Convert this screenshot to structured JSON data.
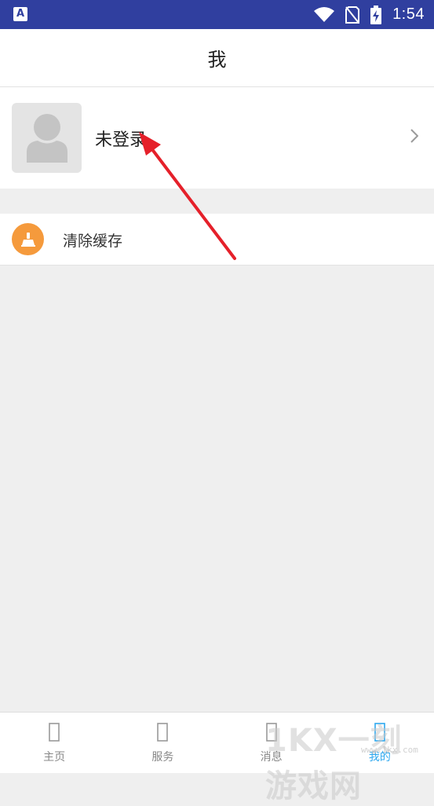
{
  "status_bar": {
    "app_badge": "A",
    "time": "1:54",
    "icons": [
      "wifi-icon",
      "no-sim-icon",
      "battery-charging-icon"
    ]
  },
  "header": {
    "title": "我"
  },
  "profile": {
    "avatar_icon": "person-silhouette-icon",
    "name": "未登录",
    "chevron_icon": "chevron-right-icon"
  },
  "menu": {
    "clear_cache": {
      "label": "清除缓存",
      "icon": "broom-icon",
      "icon_color": "#f59a3c"
    }
  },
  "tabs": [
    {
      "label": "主页",
      "icon": "home-icon",
      "active": false
    },
    {
      "label": "服务",
      "icon": "service-icon",
      "active": false
    },
    {
      "label": "消息",
      "icon": "message-icon",
      "active": false
    },
    {
      "label": "我的",
      "icon": "profile-icon",
      "active": true
    }
  ],
  "colors": {
    "status_bar": "#303f9f",
    "accent": "#2ea8ef",
    "annotation_arrow": "#e5202a"
  },
  "watermark": {
    "text": "1KX一刻游戏网",
    "site": "www.1kx.com"
  }
}
